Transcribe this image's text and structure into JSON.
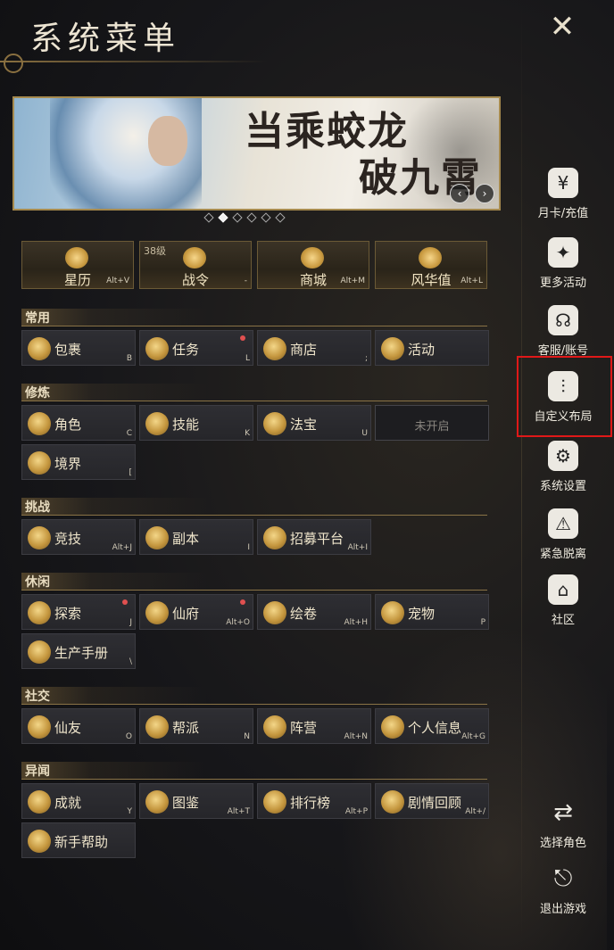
{
  "window": {
    "title": "系统菜单"
  },
  "banner": {
    "slogan_line1": "当乘蛟龙",
    "slogan_line2": "破九霄",
    "page_count": 6,
    "active_index": 1
  },
  "features": [
    {
      "name": "星历",
      "key": "Alt+V",
      "icon": "star-calendar-icon"
    },
    {
      "name": "战令",
      "key": "-",
      "level": "38级",
      "icon": "battle-pass-icon"
    },
    {
      "name": "商城",
      "key": "Alt+M",
      "icon": "mall-icon"
    },
    {
      "name": "风华值",
      "key": "Alt+L",
      "icon": "elegance-icon"
    }
  ],
  "sections": [
    {
      "title": "常用",
      "items": [
        {
          "label": "包裹",
          "key": "B",
          "icon": "bag-icon"
        },
        {
          "label": "任务",
          "key": "L",
          "badge": true,
          "icon": "quest-icon"
        },
        {
          "label": "商店",
          "key": ";",
          "icon": "shop-scale-icon"
        },
        {
          "label": "活动",
          "key": "",
          "icon": "activity-icon"
        }
      ]
    },
    {
      "title": "修炼",
      "items": [
        {
          "label": "角色",
          "key": "C",
          "icon": "character-icon"
        },
        {
          "label": "技能",
          "key": "K",
          "icon": "skill-icon"
        },
        {
          "label": "法宝",
          "key": "U",
          "icon": "treasure-icon"
        },
        {
          "label": "未开启",
          "key": "",
          "locked": true
        },
        {
          "label": "境界",
          "key": "[",
          "icon": "realm-icon"
        }
      ]
    },
    {
      "title": "挑战",
      "items": [
        {
          "label": "竞技",
          "key": "Alt+J",
          "icon": "arena-icon"
        },
        {
          "label": "副本",
          "key": "I",
          "icon": "dungeon-icon"
        },
        {
          "label": "招募平台",
          "key": "Alt+I",
          "icon": "recruit-icon"
        }
      ]
    },
    {
      "title": "休闲",
      "items": [
        {
          "label": "探索",
          "key": "J",
          "badge": true,
          "icon": "explore-icon"
        },
        {
          "label": "仙府",
          "key": "Alt+O",
          "badge": true,
          "icon": "mansion-icon"
        },
        {
          "label": "绘卷",
          "key": "Alt+H",
          "icon": "scroll-painting-icon"
        },
        {
          "label": "宠物",
          "key": "P",
          "icon": "pet-icon"
        },
        {
          "label": "生产手册",
          "key": "\\",
          "icon": "production-book-icon"
        }
      ]
    },
    {
      "title": "社交",
      "items": [
        {
          "label": "仙友",
          "key": "O",
          "icon": "friends-icon"
        },
        {
          "label": "帮派",
          "key": "N",
          "icon": "guild-icon"
        },
        {
          "label": "阵营",
          "key": "Alt+N",
          "icon": "faction-icon"
        },
        {
          "label": "个人信息",
          "key": "Alt+G",
          "icon": "profile-icon"
        }
      ]
    },
    {
      "title": "异闻",
      "items": [
        {
          "label": "成就",
          "key": "Y",
          "icon": "achievement-icon"
        },
        {
          "label": "图鉴",
          "key": "Alt+T",
          "icon": "codex-icon"
        },
        {
          "label": "排行榜",
          "key": "Alt+P",
          "icon": "leaderboard-icon"
        },
        {
          "label": "剧情回顾",
          "key": "Alt+/",
          "icon": "story-review-icon"
        },
        {
          "label": "新手帮助",
          "key": "",
          "icon": "newbie-help-icon"
        }
      ]
    }
  ],
  "sidebar": [
    {
      "label": "月卡/充值",
      "icon": "monthly-card-icon",
      "glyph": "¥"
    },
    {
      "label": "更多活动",
      "icon": "more-activities-icon",
      "glyph": "✦"
    },
    {
      "label": "客服/账号",
      "icon": "support-headset-icon",
      "glyph": "☊"
    },
    {
      "label": "自定义布局",
      "icon": "custom-layout-icon",
      "glyph": "⫶",
      "highlighted": true
    },
    {
      "label": "系统设置",
      "icon": "settings-gear-icon",
      "glyph": "⚙"
    },
    {
      "label": "紧急脱离",
      "icon": "warning-icon",
      "glyph": "⚠"
    },
    {
      "label": "社区",
      "icon": "community-home-icon",
      "glyph": "⌂"
    },
    {
      "label": "选择角色",
      "icon": "switch-character-icon",
      "glyph": "⇄"
    },
    {
      "label": "退出游戏",
      "icon": "exit-door-icon",
      "glyph": "⎋"
    }
  ],
  "colors": {
    "accent_gold": "#c99a40",
    "highlight_red": "#e01818",
    "badge_red": "#e05050"
  }
}
